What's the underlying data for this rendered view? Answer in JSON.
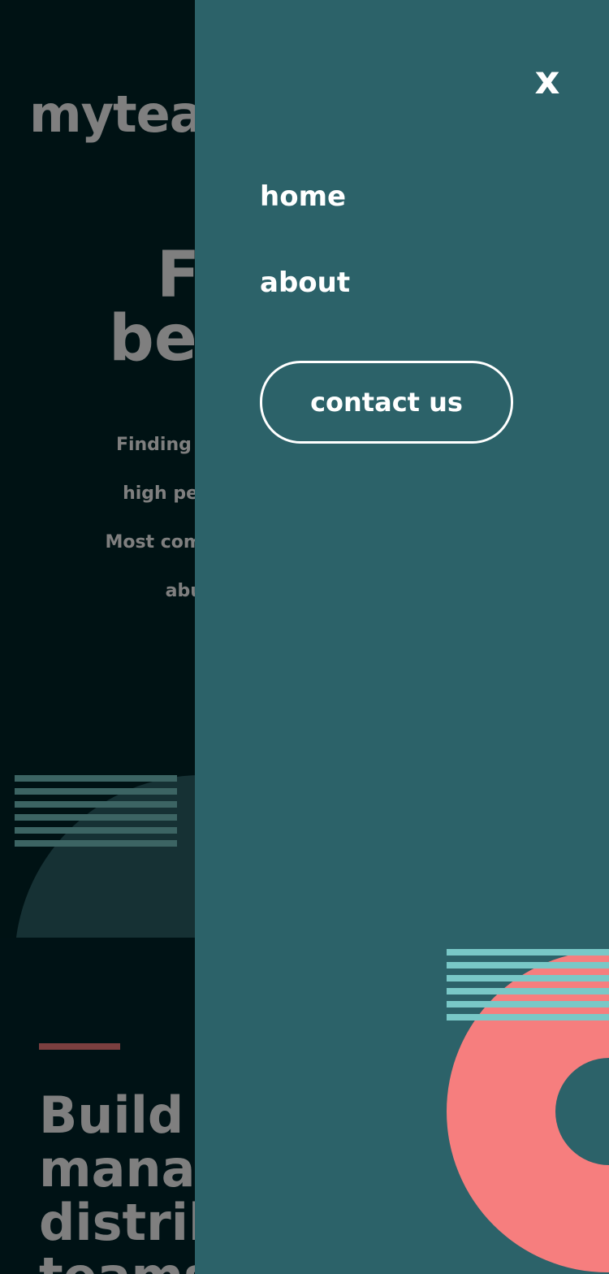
{
  "background_page": {
    "logo": "myteam",
    "hero_title_lines": [
      "Find the",
      "best talent"
    ],
    "hero_text_lines": [
      "Finding the right people and building",
      "high performing teams can be hard.",
      "Most companies aren't tapping into the",
      "abundance of global talent."
    ],
    "features_title_lines": [
      "Build & manage",
      "manage",
      "distributed",
      "teams"
    ]
  },
  "menu": {
    "close_label": "x",
    "nav": [
      {
        "label": "home"
      },
      {
        "label": "about"
      }
    ],
    "contact_button": "contact us"
  },
  "colors": {
    "overlay_menu": "#2C6269",
    "coral": "#F67E7E",
    "aqua": "#79C8C7",
    "dark_bg": "#012529"
  }
}
